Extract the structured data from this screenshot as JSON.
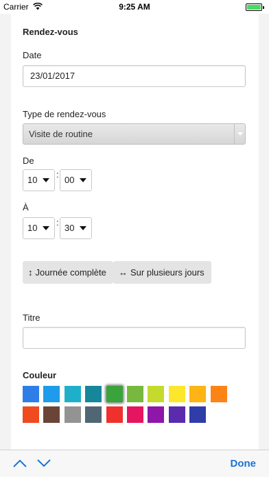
{
  "status_bar": {
    "carrier": "Carrier",
    "time": "9:25 AM"
  },
  "form": {
    "section_title": "Rendez-vous",
    "date": {
      "label": "Date",
      "value": "23/01/2017"
    },
    "type": {
      "label": "Type de rendez-vous",
      "selected": "Visite de routine"
    },
    "start": {
      "label": "De",
      "hour": "10",
      "minute": "00"
    },
    "end": {
      "label": "À",
      "hour": "10",
      "minute": "30"
    },
    "time_separator": ":",
    "buttons": {
      "all_day": "Journée complète",
      "multi_day": "Sur plusieurs jours"
    },
    "title": {
      "label": "Titre",
      "value": ""
    },
    "color": {
      "label": "Couleur",
      "selected_index": 4,
      "swatches": [
        "#2f7ee8",
        "#1f9bec",
        "#1fb0c9",
        "#16879a",
        "#3aa33a",
        "#79b83e",
        "#c4db2d",
        "#fde72d",
        "#fdb414",
        "#fc8416",
        "#f04a1f",
        "#6a4537",
        "#939393",
        "#506674",
        "#f0302d",
        "#e6155f",
        "#8e16a8",
        "#5a2bad",
        "#2f3da8"
      ]
    }
  },
  "toolbar": {
    "done_label": "Done"
  },
  "icons": {
    "wifi": "wifi-icon",
    "battery": "battery-icon",
    "all_day": "vertical-arrows-icon",
    "multi_day": "horizontal-arrows-icon",
    "up": "chevron-up-icon",
    "down": "chevron-down-icon"
  }
}
